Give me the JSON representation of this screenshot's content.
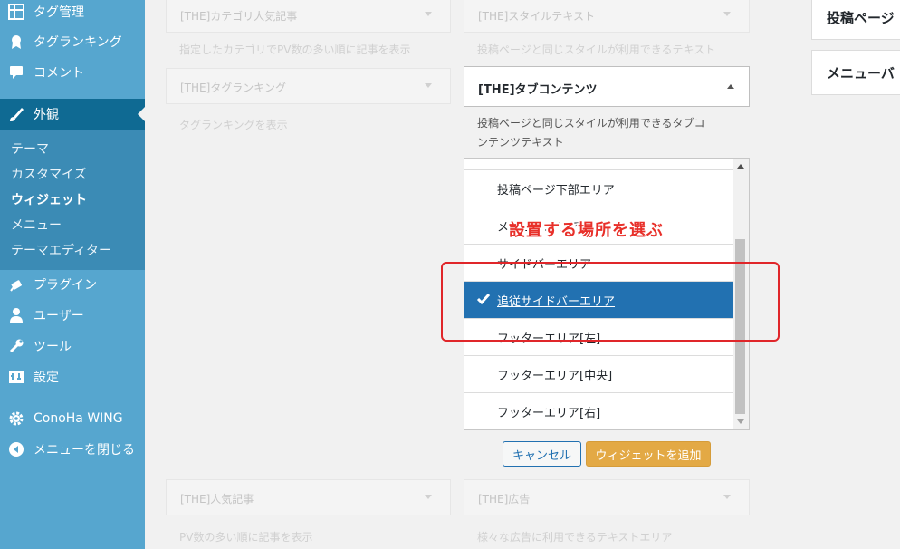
{
  "sidebar": {
    "items_top": [
      {
        "label": "タグ管理",
        "icon": "table-icon"
      },
      {
        "label": "タグランキング",
        "icon": "award-icon"
      },
      {
        "label": "コメント",
        "icon": "comment-icon"
      },
      {
        "label": "外観",
        "icon": "brush-icon"
      }
    ],
    "submenu": [
      "テーマ",
      "カスタマイズ",
      "ウィジェット",
      "メニュー",
      "テーマエディター"
    ],
    "items_bottom": [
      {
        "label": "プラグイン",
        "icon": "plugin-icon"
      },
      {
        "label": "ユーザー",
        "icon": "user-icon"
      },
      {
        "label": "ツール",
        "icon": "wrench-icon"
      },
      {
        "label": "設定",
        "icon": "settings-icon"
      },
      {
        "label": "ConoHa WING",
        "icon": "gear-icon"
      },
      {
        "label": "メニューを閉じる",
        "icon": "collapse-icon"
      }
    ]
  },
  "widgets": {
    "category_popular": {
      "title": "[THE]カテゴリ人気記事",
      "desc": "指定したカテゴリでPV数の多い順に記事を表示"
    },
    "style_text": {
      "title": "[THE]スタイルテキスト",
      "desc": "投稿ページと同じスタイルが利用できるテキスト"
    },
    "tag_ranking": {
      "title": "[THE]タグランキング",
      "desc": "タグランキングを表示"
    },
    "tab_contents": {
      "title": "[THE]タブコンテンツ",
      "desc": "投稿ページと同じスタイルが利用できるタブコンテンツテキスト"
    },
    "popular": {
      "title": "[THE]人気記事",
      "desc": "PV数の多い順に記事を表示"
    },
    "ad": {
      "title": "[THE]広告",
      "desc": "様々な広告に利用できるテキストエリア"
    }
  },
  "chooser": {
    "areas": [
      "投稿ページ下部エリア",
      "メニューエリア",
      "サイドバーエリア",
      "追従サイドバーエリア",
      "フッターエリア[左]",
      "フッターエリア[中央]",
      "フッターエリア[右]"
    ],
    "selected_index": 3
  },
  "annotation": {
    "text": "設置する場所を選ぶ",
    "color": "#e0262a"
  },
  "buttons": {
    "cancel": "キャンセル",
    "add": "ウィジェットを追加"
  },
  "right_column": [
    "投稿ページ",
    "メニューバ"
  ],
  "colors": {
    "sidebar": "#56a6cf",
    "active": "#0f6a93",
    "selected": "#2271b1",
    "primary_button": "#e3a945"
  }
}
